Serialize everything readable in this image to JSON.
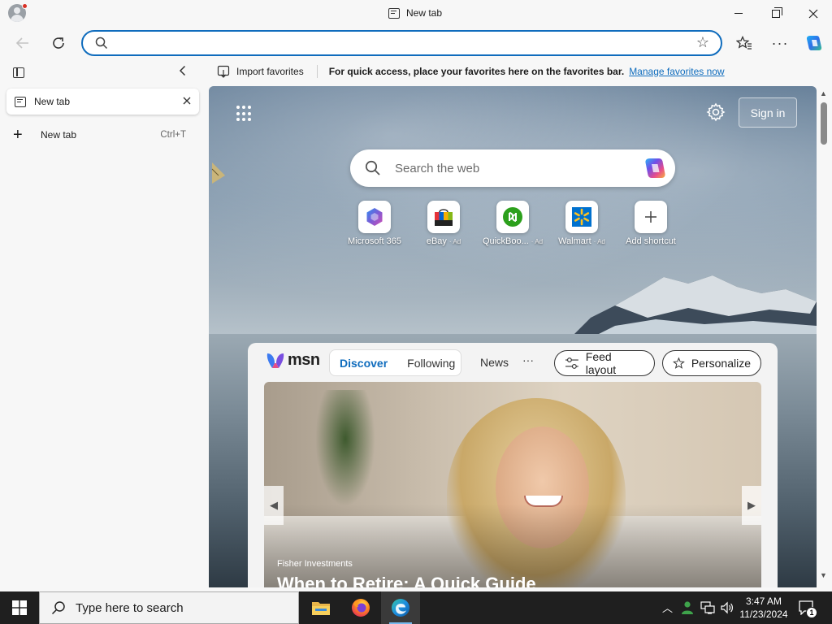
{
  "window": {
    "title": "New tab"
  },
  "toolbar": {
    "address_value": "",
    "address_placeholder": ""
  },
  "favorites_bar": {
    "import_label": "Import favorites",
    "message": "For quick access, place your favorites here on the favorites bar.",
    "link": "Manage favorites now"
  },
  "sidebar": {
    "tabs": [
      {
        "label": "New tab"
      }
    ],
    "new_tab": {
      "label": "New tab",
      "shortcut": "Ctrl+T"
    }
  },
  "ntp": {
    "signin_label": "Sign in",
    "search_placeholder": "Search the web",
    "shortcuts": [
      {
        "label": "Microsoft 365",
        "ad": "",
        "icon": "microsoft-365-icon",
        "color": "#7b5cd6"
      },
      {
        "label": "eBay",
        "ad": "Ad",
        "icon": "ebay-bag-icon",
        "color": "#e53238"
      },
      {
        "label": "QuickBoo...",
        "ad": "Ad",
        "icon": "quickbooks-icon",
        "color": "#2ca01c"
      },
      {
        "label": "Walmart",
        "ad": "Ad",
        "icon": "walmart-spark-icon",
        "color": "#0071ce"
      },
      {
        "label": "Add shortcut",
        "ad": "",
        "icon": "plus-icon",
        "color": "#444444"
      }
    ]
  },
  "feed": {
    "brand": "msn",
    "tabs": {
      "discover": "Discover",
      "following": "Following",
      "news": "News",
      "more": "···"
    },
    "feed_layout_label": "Feed layout",
    "personalize_label": "Personalize",
    "hero": {
      "source": "Fisher Investments",
      "headline": "When to Retire: A Quick Guide"
    }
  },
  "taskbar": {
    "search_placeholder": "Type here to search",
    "time": "3:47 AM",
    "date": "11/23/2024",
    "notification_count": "1"
  },
  "colors": {
    "accent": "#0f6cbd",
    "taskbar": "#1f1f1f"
  }
}
